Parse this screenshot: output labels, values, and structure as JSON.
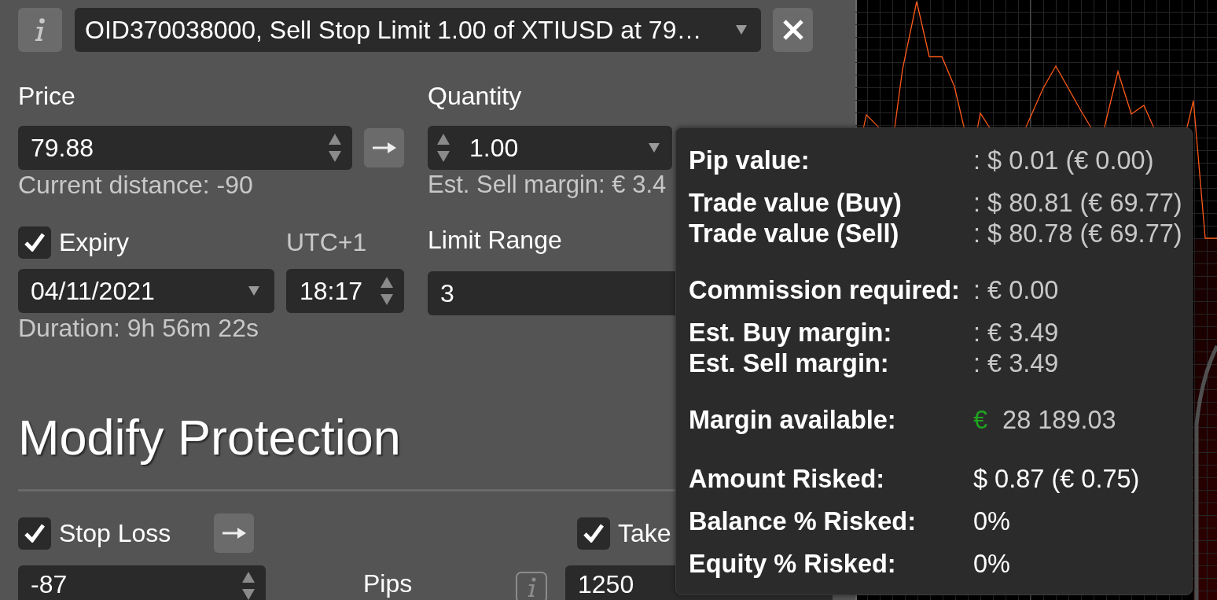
{
  "order_select": {
    "value": "OID370038000, Sell Stop Limit 1.00 of XTIUSD at 79…"
  },
  "price": {
    "label": "Price",
    "value": "79.88",
    "hint": "Current distance: -90"
  },
  "quantity": {
    "label": "Quantity",
    "value": "1.00",
    "hint": "Est. Sell margin: € 3.4"
  },
  "expiry": {
    "label": "Expiry",
    "checked": true,
    "timezone": "UTC+1",
    "date": "04/11/2021",
    "time": "18:17",
    "hint": "Duration: 9h 56m 22s"
  },
  "limit_range": {
    "label": "Limit Range",
    "value": "3"
  },
  "protection": {
    "title": "Modify Protection",
    "stop_loss": {
      "label": "Stop Loss",
      "checked": true,
      "value": "-87",
      "unit": "Pips"
    },
    "take_profit": {
      "label": "Take",
      "checked": true,
      "value": "1250"
    }
  },
  "info_tooltip": {
    "groups": [
      {
        "rows": [
          {
            "label": "Pip value:",
            "kind": "plain",
            "value": ": $ 0.01 (€ 0.00)"
          }
        ]
      },
      {
        "rows": [
          {
            "label": "Trade value (Buy)",
            "kind": "plain",
            "value": ": $ 80.81 (€ 69.77)"
          },
          {
            "label": "Trade value (Sell)",
            "kind": "plain",
            "value": ": $ 80.78 (€ 69.77)"
          }
        ]
      },
      {
        "rows": [
          {
            "label": "Commission required:",
            "kind": "plain",
            "value": ": € 0.00"
          }
        ]
      },
      {
        "rows": [
          {
            "label": "Est. Buy margin:",
            "kind": "plain",
            "value": ": € 3.49"
          },
          {
            "label": "Est. Sell margin:",
            "kind": "plain",
            "value": ": € 3.49"
          }
        ]
      },
      {
        "rows": [
          {
            "label": "Margin available:",
            "kind": "currency",
            "currency": "€",
            "value": "28 189.03"
          }
        ]
      },
      {
        "rows": [
          {
            "label": "Amount Risked:",
            "kind": "risk",
            "value": "$ 0.87 (€ 0.75)"
          }
        ]
      },
      {
        "rows": [
          {
            "label": "Balance % Risked:",
            "kind": "risk",
            "value": "0%"
          }
        ]
      },
      {
        "rows": [
          {
            "label": "Equity % Risked:",
            "kind": "risk",
            "value": "0%"
          }
        ]
      }
    ]
  }
}
